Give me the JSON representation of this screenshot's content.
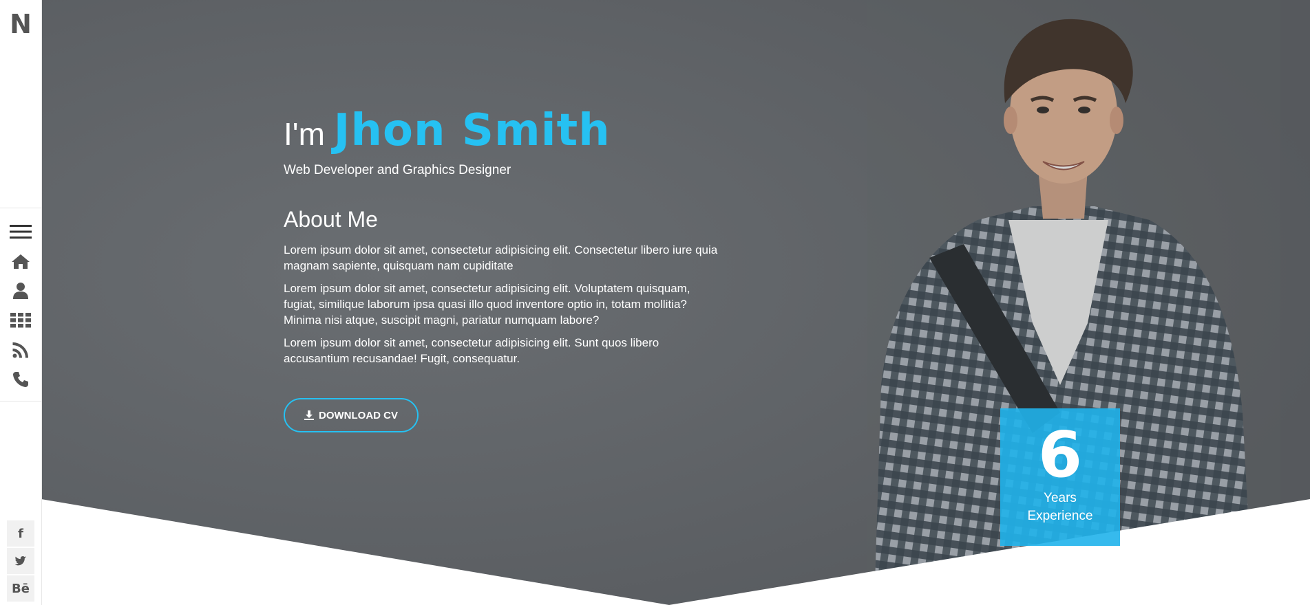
{
  "brand": {
    "logo_letter": "N"
  },
  "nav": [
    {
      "icon": "menu-icon"
    },
    {
      "icon": "home-icon"
    },
    {
      "icon": "user-icon"
    },
    {
      "icon": "grid-icon"
    },
    {
      "icon": "rss-icon"
    },
    {
      "icon": "phone-icon"
    }
  ],
  "social": [
    {
      "icon": "facebook-icon",
      "glyph": "f"
    },
    {
      "icon": "twitter-icon",
      "glyph": "t"
    },
    {
      "icon": "behance-icon",
      "glyph": "Bē"
    }
  ],
  "hero": {
    "greeting_prefix": "I'm",
    "name": "Jhon Smith",
    "subtitle": "Web Developer and Graphics Designer"
  },
  "about": {
    "title": "About Me",
    "paragraphs": [
      "Lorem ipsum dolor sit amet, consectetur adipisicing elit. Consectetur libero iure quia magnam sapiente, quisquam nam cupiditate",
      "Lorem ipsum dolor sit amet, consectetur adipisicing elit. Voluptatem quisquam, fugiat, similique laborum ipsa quasi illo quod inventore optio in, totam mollitia? Minima nisi atque, suscipit magni, pariatur numquam labore?",
      "Lorem ipsum dolor sit amet, consectetur adipisicing elit. Sunt quos libero accusantium recusandae! Fugit, consequatur."
    ],
    "download_label": "DOWNLOAD CV"
  },
  "experience": {
    "years": "6",
    "label_line1": "Years",
    "label_line2": "Experience"
  },
  "colors": {
    "accent": "#26c1f2",
    "overlay": "#5e6266",
    "experience_box": "#20b2eb"
  }
}
